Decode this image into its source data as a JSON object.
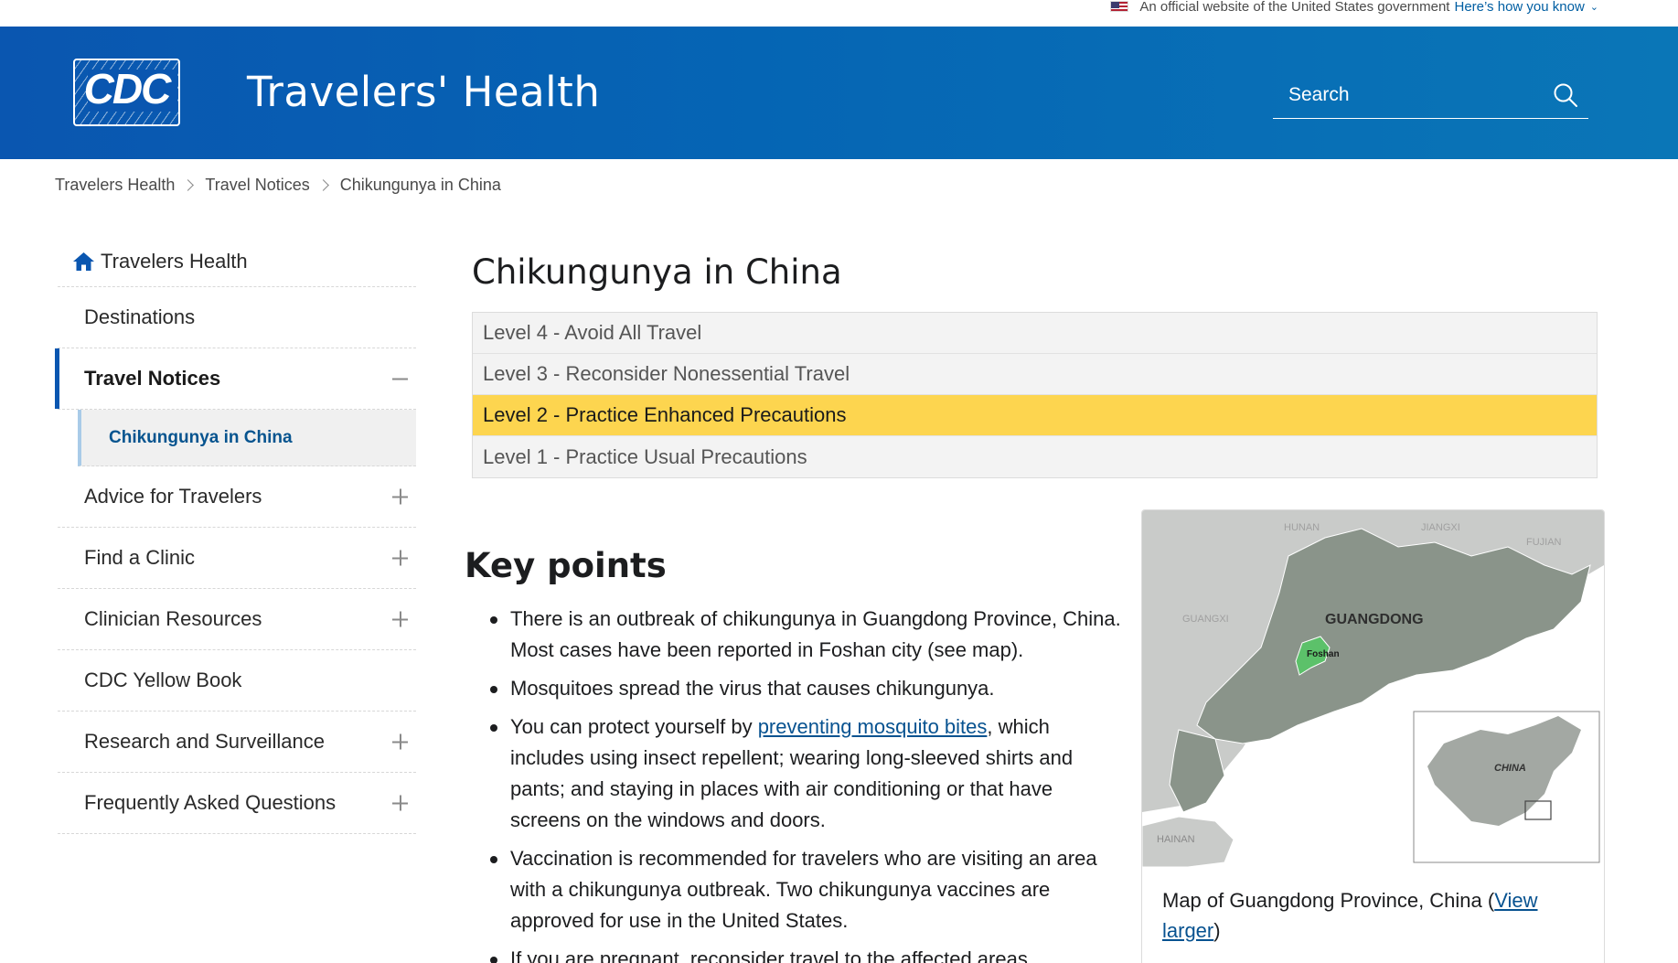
{
  "gov_banner": {
    "text": "An official website of the United States government",
    "link": "Here’s how you know"
  },
  "header": {
    "logo_text": "CDC",
    "title": "Travelers' Health",
    "search_placeholder": "Search"
  },
  "breadcrumb": [
    "Travelers Health",
    "Travel Notices",
    "Chikungunya in China"
  ],
  "sidebar": {
    "home": "Travelers Health",
    "items": [
      {
        "label": "Destinations",
        "toggle": "none"
      },
      {
        "label": "Travel Notices",
        "toggle": "minus"
      },
      {
        "label": "Advice for Travelers",
        "toggle": "plus"
      },
      {
        "label": "Find a Clinic",
        "toggle": "plus"
      },
      {
        "label": "Clinician Resources",
        "toggle": "plus"
      },
      {
        "label": "CDC Yellow Book",
        "toggle": "none"
      },
      {
        "label": "Research and Surveillance",
        "toggle": "plus"
      },
      {
        "label": "Frequently Asked Questions",
        "toggle": "plus"
      }
    ],
    "sub_item": "Chikungunya in China"
  },
  "main": {
    "title": "Chikungunya in China",
    "levels": [
      "Level 4 - Avoid All Travel",
      "Level 3 - Reconsider Nonessential Travel",
      "Level 2 - Practice Enhanced Precautions",
      "Level 1 - Practice Usual Precautions"
    ],
    "current_level": 2,
    "key_points_title": "Key points",
    "key_points": {
      "p1": "There is an outbreak of chikungunya in Guangdong Province, China. Most cases have been reported in Foshan city (see map).",
      "p2": "Mosquitoes spread the virus that causes chikungunya.",
      "p3_pre": "You can protect yourself by ",
      "p3_link": "preventing mosquito bites",
      "p3_post": ", which includes using insect repellent; wearing long-sleeved shirts and pants; and staying in places with air conditioning or that have screens on the windows and  doors.",
      "p4": "Vaccination is recommended for travelers who are visiting an area with a chikungunya outbreak. Two chikungunya vaccines are approved for use in the United States.",
      "p5": "If you are pregnant, reconsider travel to the affected areas."
    }
  },
  "map": {
    "labels": {
      "hunan": "HUNAN",
      "jiangxi": "JIANGXI",
      "fujian": "FUJIAN",
      "guangxi": "GUANGXI",
      "guangdong": "GUANGDONG",
      "foshan": "Foshan",
      "hainan": "HAINAN",
      "china": "CHINA"
    },
    "caption_pre": "Map of Guangdong Province, China (",
    "caption_link": "View larger",
    "caption_post": ")",
    "colors": {
      "province": "#8a948a",
      "highlight": "#5cc16a",
      "background": "#c9cbc9"
    }
  },
  "colors": {
    "header": "#0a56b0",
    "level_current": "#fdd54f",
    "link": "#075290"
  }
}
